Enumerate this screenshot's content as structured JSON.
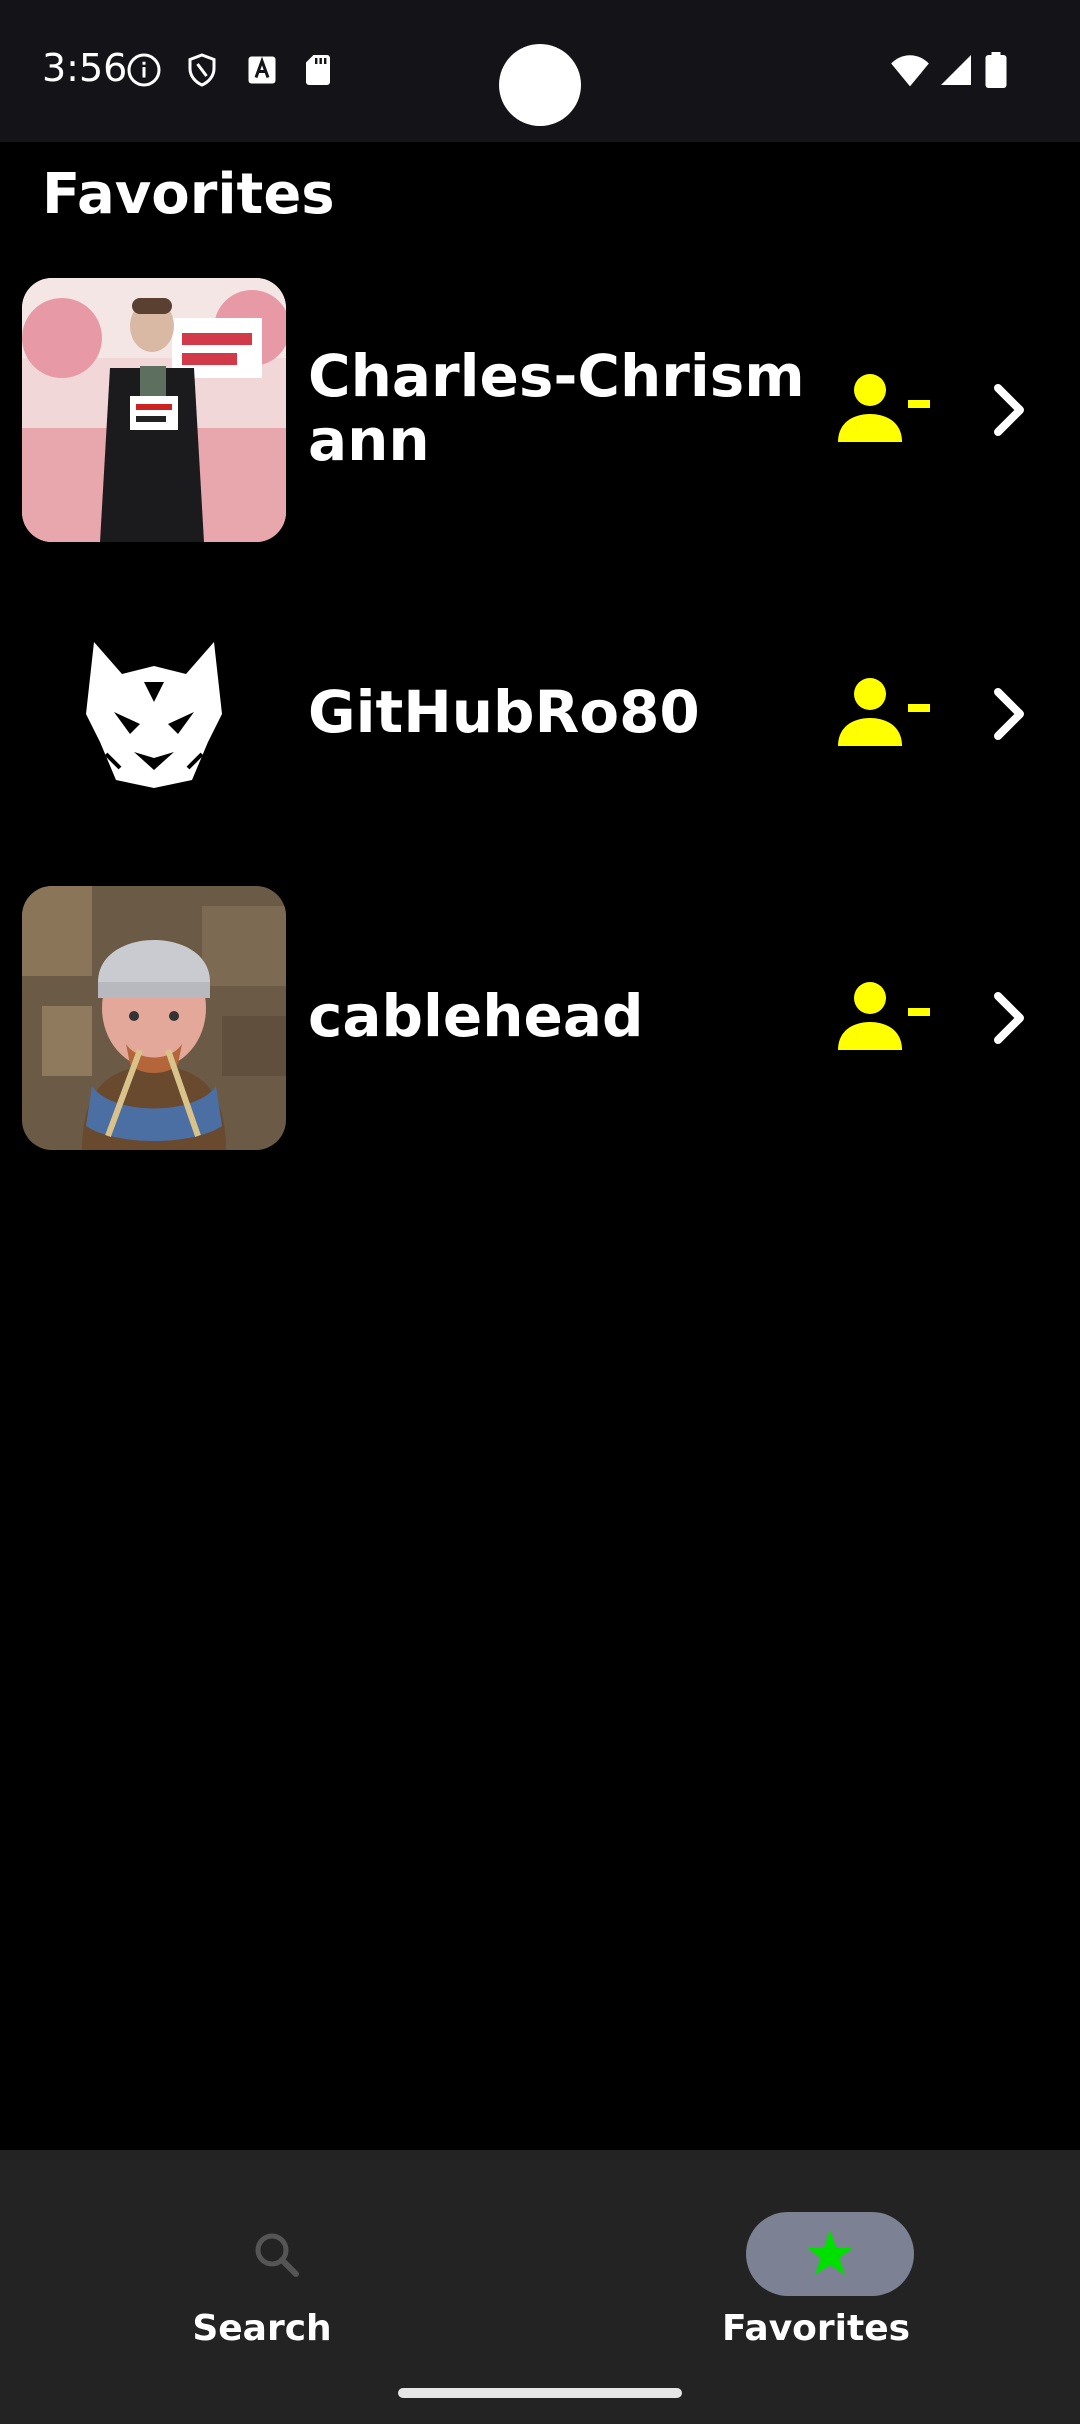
{
  "status_bar": {
    "time": "3:56",
    "icons": [
      "info-icon",
      "shield-icon",
      "font-icon",
      "sd-card-icon",
      "wifi-icon",
      "signal-icon",
      "battery-icon"
    ]
  },
  "header": {
    "title": "Favorites"
  },
  "favorites": [
    {
      "username": "Charles-Chrismann",
      "avatar": "person-photo-avatar",
      "remove_icon": "person-remove-icon",
      "open_icon": "chevron-right-icon"
    },
    {
      "username": "GitHubRo80",
      "avatar": "wolf-logo-avatar",
      "remove_icon": "person-remove-icon",
      "open_icon": "chevron-right-icon"
    },
    {
      "username": "cablehead",
      "avatar": "person-photo-avatar",
      "remove_icon": "person-remove-icon",
      "open_icon": "chevron-right-icon"
    }
  ],
  "bottom_nav": {
    "items": [
      {
        "label": "Search",
        "icon": "search-icon",
        "selected": false
      },
      {
        "label": "Favorites",
        "icon": "star-icon",
        "selected": true
      }
    ]
  },
  "colors": {
    "background": "#000000",
    "status_bar": "#141418",
    "accent_remove": "#FFFF00",
    "star": "#00E000",
    "nav_pill": "#7C8193",
    "nav_bar": "#232323"
  }
}
